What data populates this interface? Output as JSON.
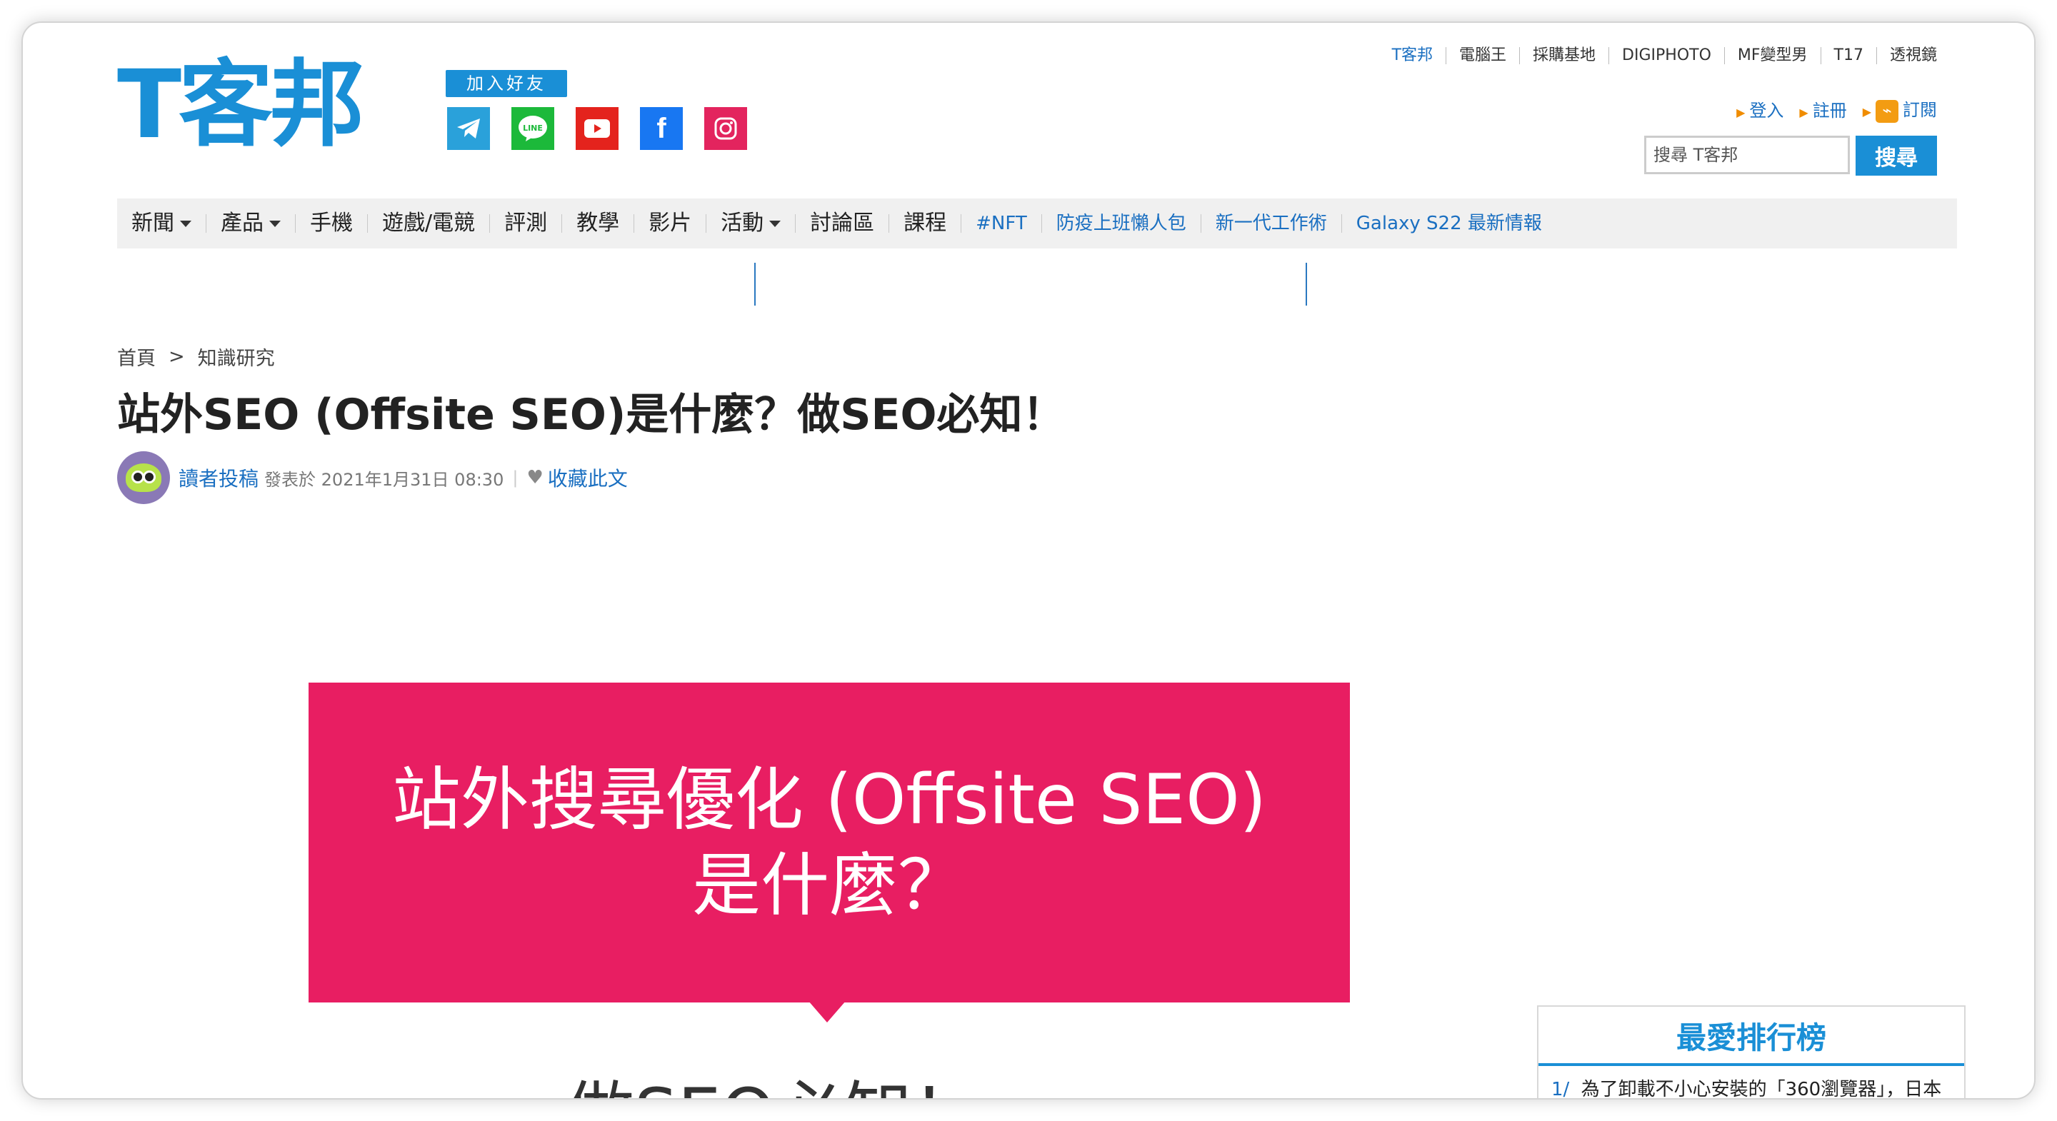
{
  "top_links": [
    {
      "label": "T客邦",
      "active": true
    },
    {
      "label": "電腦王",
      "active": false
    },
    {
      "label": "採購基地",
      "active": false
    },
    {
      "label": "DIGIPHOTO",
      "active": false
    },
    {
      "label": "MF變型男",
      "active": false
    },
    {
      "label": "T17",
      "active": false
    },
    {
      "label": "透視鏡",
      "active": false
    }
  ],
  "logo": {
    "text": "T客邦"
  },
  "join": {
    "label": "加入好友"
  },
  "social": [
    {
      "name": "telegram-icon",
      "glyph": "➤"
    },
    {
      "name": "line-icon",
      "glyph": "LINE"
    },
    {
      "name": "youtube-icon",
      "glyph": "▶"
    },
    {
      "name": "facebook-icon",
      "glyph": "f"
    },
    {
      "name": "instagram-icon",
      "glyph": "◎"
    }
  ],
  "account": {
    "login": "登入",
    "register": "註冊",
    "subscribe": "訂閱"
  },
  "search": {
    "placeholder": "搜尋 T客邦",
    "button": "搜尋"
  },
  "nav": [
    {
      "label": "新聞",
      "caret": true,
      "blue": false
    },
    {
      "label": "產品",
      "caret": true,
      "blue": false
    },
    {
      "label": "手機",
      "caret": false,
      "blue": false
    },
    {
      "label": "遊戲/電競",
      "caret": false,
      "blue": false
    },
    {
      "label": "評測",
      "caret": false,
      "blue": false
    },
    {
      "label": "教學",
      "caret": false,
      "blue": false
    },
    {
      "label": "影片",
      "caret": false,
      "blue": false
    },
    {
      "label": "活動",
      "caret": true,
      "blue": false
    },
    {
      "label": "討論區",
      "caret": false,
      "blue": false
    },
    {
      "label": "課程",
      "caret": false,
      "blue": false
    },
    {
      "label": "#NFT",
      "caret": false,
      "blue": true
    },
    {
      "label": "防疫上班懶人包",
      "caret": false,
      "blue": true
    },
    {
      "label": "新一代工作術",
      "caret": false,
      "blue": true
    },
    {
      "label": "Galaxy S22 最新情報",
      "caret": false,
      "blue": true
    }
  ],
  "breadcrumb": {
    "home": "首頁",
    "separator": ">",
    "category": "知識研究"
  },
  "article": {
    "title": "站外SEO (Offsite SEO)是什麼？做SEO必知！",
    "author": "讀者投稿",
    "published_label": "發表於",
    "published": "2021年1月31日 08:30",
    "favorite": "收藏此文"
  },
  "hero": {
    "line1": "站外搜尋優化 (Offsite SEO)",
    "line2": "是什麼？",
    "subtitle": "做SEO必知！"
  },
  "ranking": {
    "title": "最愛排行榜",
    "items": [
      {
        "num": "1/",
        "text": "為了卸載不小心安裝的「360瀏覽器」，日本"
      }
    ]
  },
  "colors": {
    "brand": "#1a8fd6",
    "link": "#1a6fc1",
    "hero": "#e81e62"
  }
}
